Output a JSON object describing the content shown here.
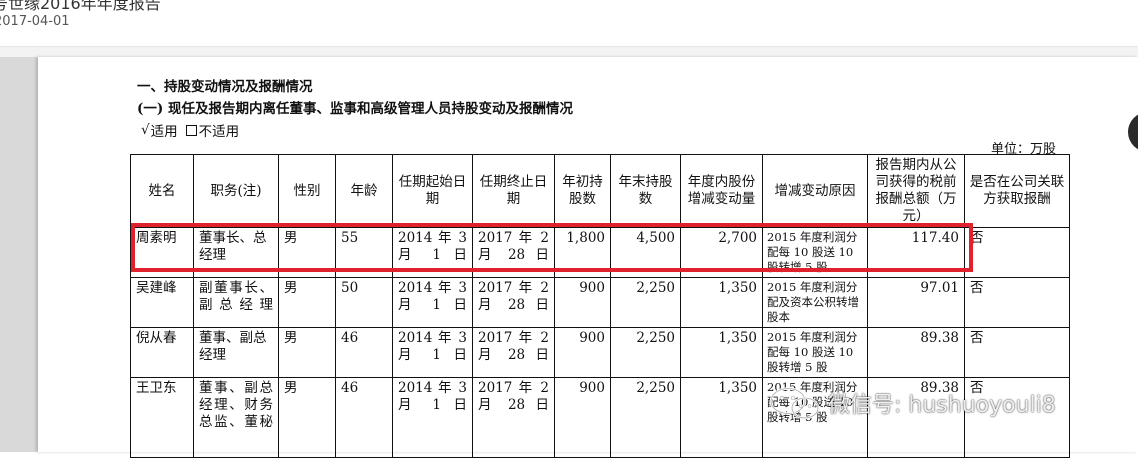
{
  "doc_header": {
    "title": "号世缘2016年年度报告",
    "date": "2017-04-01"
  },
  "content": {
    "heading1": "一、持股变动情况及报酬情况",
    "heading2": "(一) 现任及报告期内离任董事、监事和高级管理人员持股变动及报酬情况",
    "applicable_check": "√",
    "applicable_label": "适用",
    "not_applicable_label": "不适用",
    "unit": "单位：万股"
  },
  "table": {
    "headers": [
      "姓名",
      "职务(注)",
      "性别",
      "年龄",
      "任期起始日期",
      "任期终止日期",
      "年初持股数",
      "年末持股数",
      "年度内股份增减变动量",
      "增减变动原因",
      "报告期内从公司获得的税前报酬总额（万元）",
      "是否在公司关联方获取报酬"
    ],
    "rows": [
      {
        "name": "周素明",
        "position": "董事长、总经理",
        "gender": "男",
        "age": "55",
        "start": "2014 年 3 月 1 日",
        "end": "2017 年 2 月 28 日",
        "begin_shares": "1,800",
        "end_shares": "4,500",
        "change": "2,700",
        "reason": "2015 年度利润分配每 10 股送 10 股转增 5 股",
        "pay": "117.40",
        "related": "否"
      },
      {
        "name": "吴建峰",
        "position": "副董事长、副总经理",
        "gender": "男",
        "age": "50",
        "start": "2014 年 3 月 1 日",
        "end": "2017 年 2 月 28 日",
        "begin_shares": "900",
        "end_shares": "2,250",
        "change": "1,350",
        "reason": "2015 年度利润分配及资本公积转增股本",
        "pay": "97.01",
        "related": "否"
      },
      {
        "name": "倪从春",
        "position": "董事、副总经理",
        "gender": "男",
        "age": "46",
        "start": "2014 年 3 月 1 日",
        "end": "2017 年 2 月 28 日",
        "begin_shares": "900",
        "end_shares": "2,250",
        "change": "1,350",
        "reason": "2015 年度利润分配每 10 股送 10 股转增 5 股",
        "pay": "89.38",
        "related": "否"
      },
      {
        "name": "王卫东",
        "position": "董事、副总经理、财务总监、董秘",
        "gender": "男",
        "age": "46",
        "start": "2014 年 3 月 1 日",
        "end": "2017 年 2 月 28 日",
        "begin_shares": "900",
        "end_shares": "2,250",
        "change": "1,350",
        "reason": "2015 年度利润分配每 10 股送 10 股转增 5 股",
        "pay": "89.38",
        "related": "否"
      }
    ]
  },
  "watermark": {
    "text": "微信号: hushuoyouli8",
    "icon": "wechat-icon"
  },
  "colors": {
    "highlight": "#e0212e",
    "gutter": "#d9d9d9"
  }
}
